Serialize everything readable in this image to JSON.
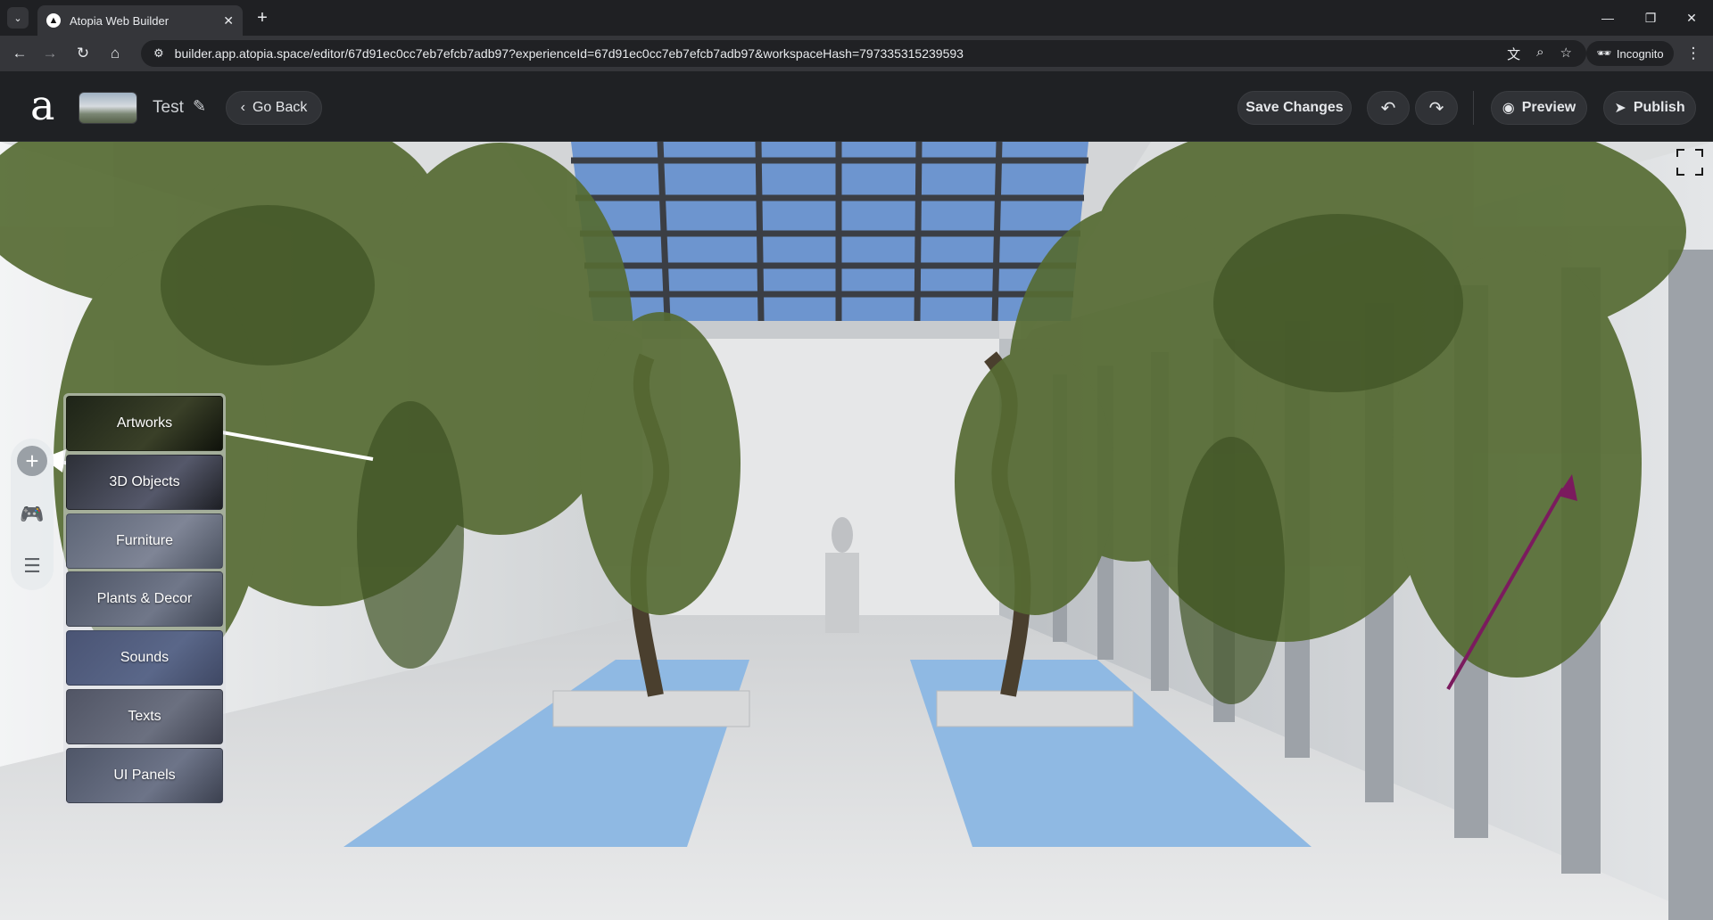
{
  "browser": {
    "tab_title": "Atopia Web Builder",
    "tab_list_icon": "chevron-down-icon",
    "url": "builder.app.atopia.space/editor/67d91ec0cc7eb7efcb7adb97?experienceId=67d91ec0cc7eb7efcb7adb97&workspaceHash=797335315239593",
    "incognito_label": "Incognito"
  },
  "header": {
    "logo": "a",
    "project_name": "Test",
    "go_back_label": "Go Back",
    "save_label": "Save Changes",
    "preview_label": "Preview",
    "publish_label": "Publish"
  },
  "menu": {
    "items": [
      {
        "label": "Artworks"
      },
      {
        "label": "3D Objects"
      },
      {
        "label": "Furniture"
      },
      {
        "label": "Plants & Decor"
      },
      {
        "label": "Sounds"
      },
      {
        "label": "Texts"
      },
      {
        "label": "UI Panels"
      }
    ]
  },
  "colors": {
    "header_bg": "#1f2124",
    "pill_bg": "#303236",
    "sky": "#6d95cf",
    "water": "#8fb9e3",
    "foliage": "#566b33",
    "annotation_arrow_white": "#ffffff",
    "annotation_arrow_purple": "#7b1b5e"
  }
}
